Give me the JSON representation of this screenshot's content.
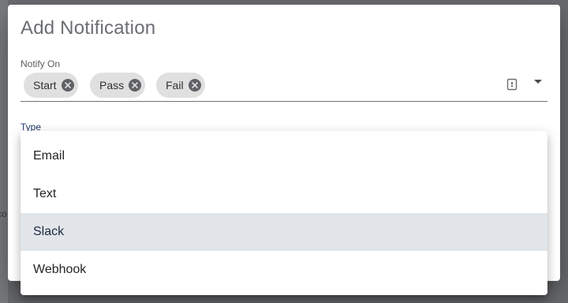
{
  "dialog": {
    "title": "Add Notification",
    "notify_on": {
      "label": "Notify On",
      "chips": [
        "Start",
        "Pass",
        "Fail"
      ]
    },
    "type": {
      "label": "Type",
      "options": [
        "Email",
        "Text",
        "Slack",
        "Webhook"
      ],
      "highlighted_option": "Slack"
    }
  },
  "background": {
    "fragment_text": "co"
  },
  "colors": {
    "backdrop": "#6a6c6f",
    "chip_bg": "#e0e0e0",
    "highlight_bg": "#e2e5e9",
    "type_label": "#1f3a66"
  }
}
